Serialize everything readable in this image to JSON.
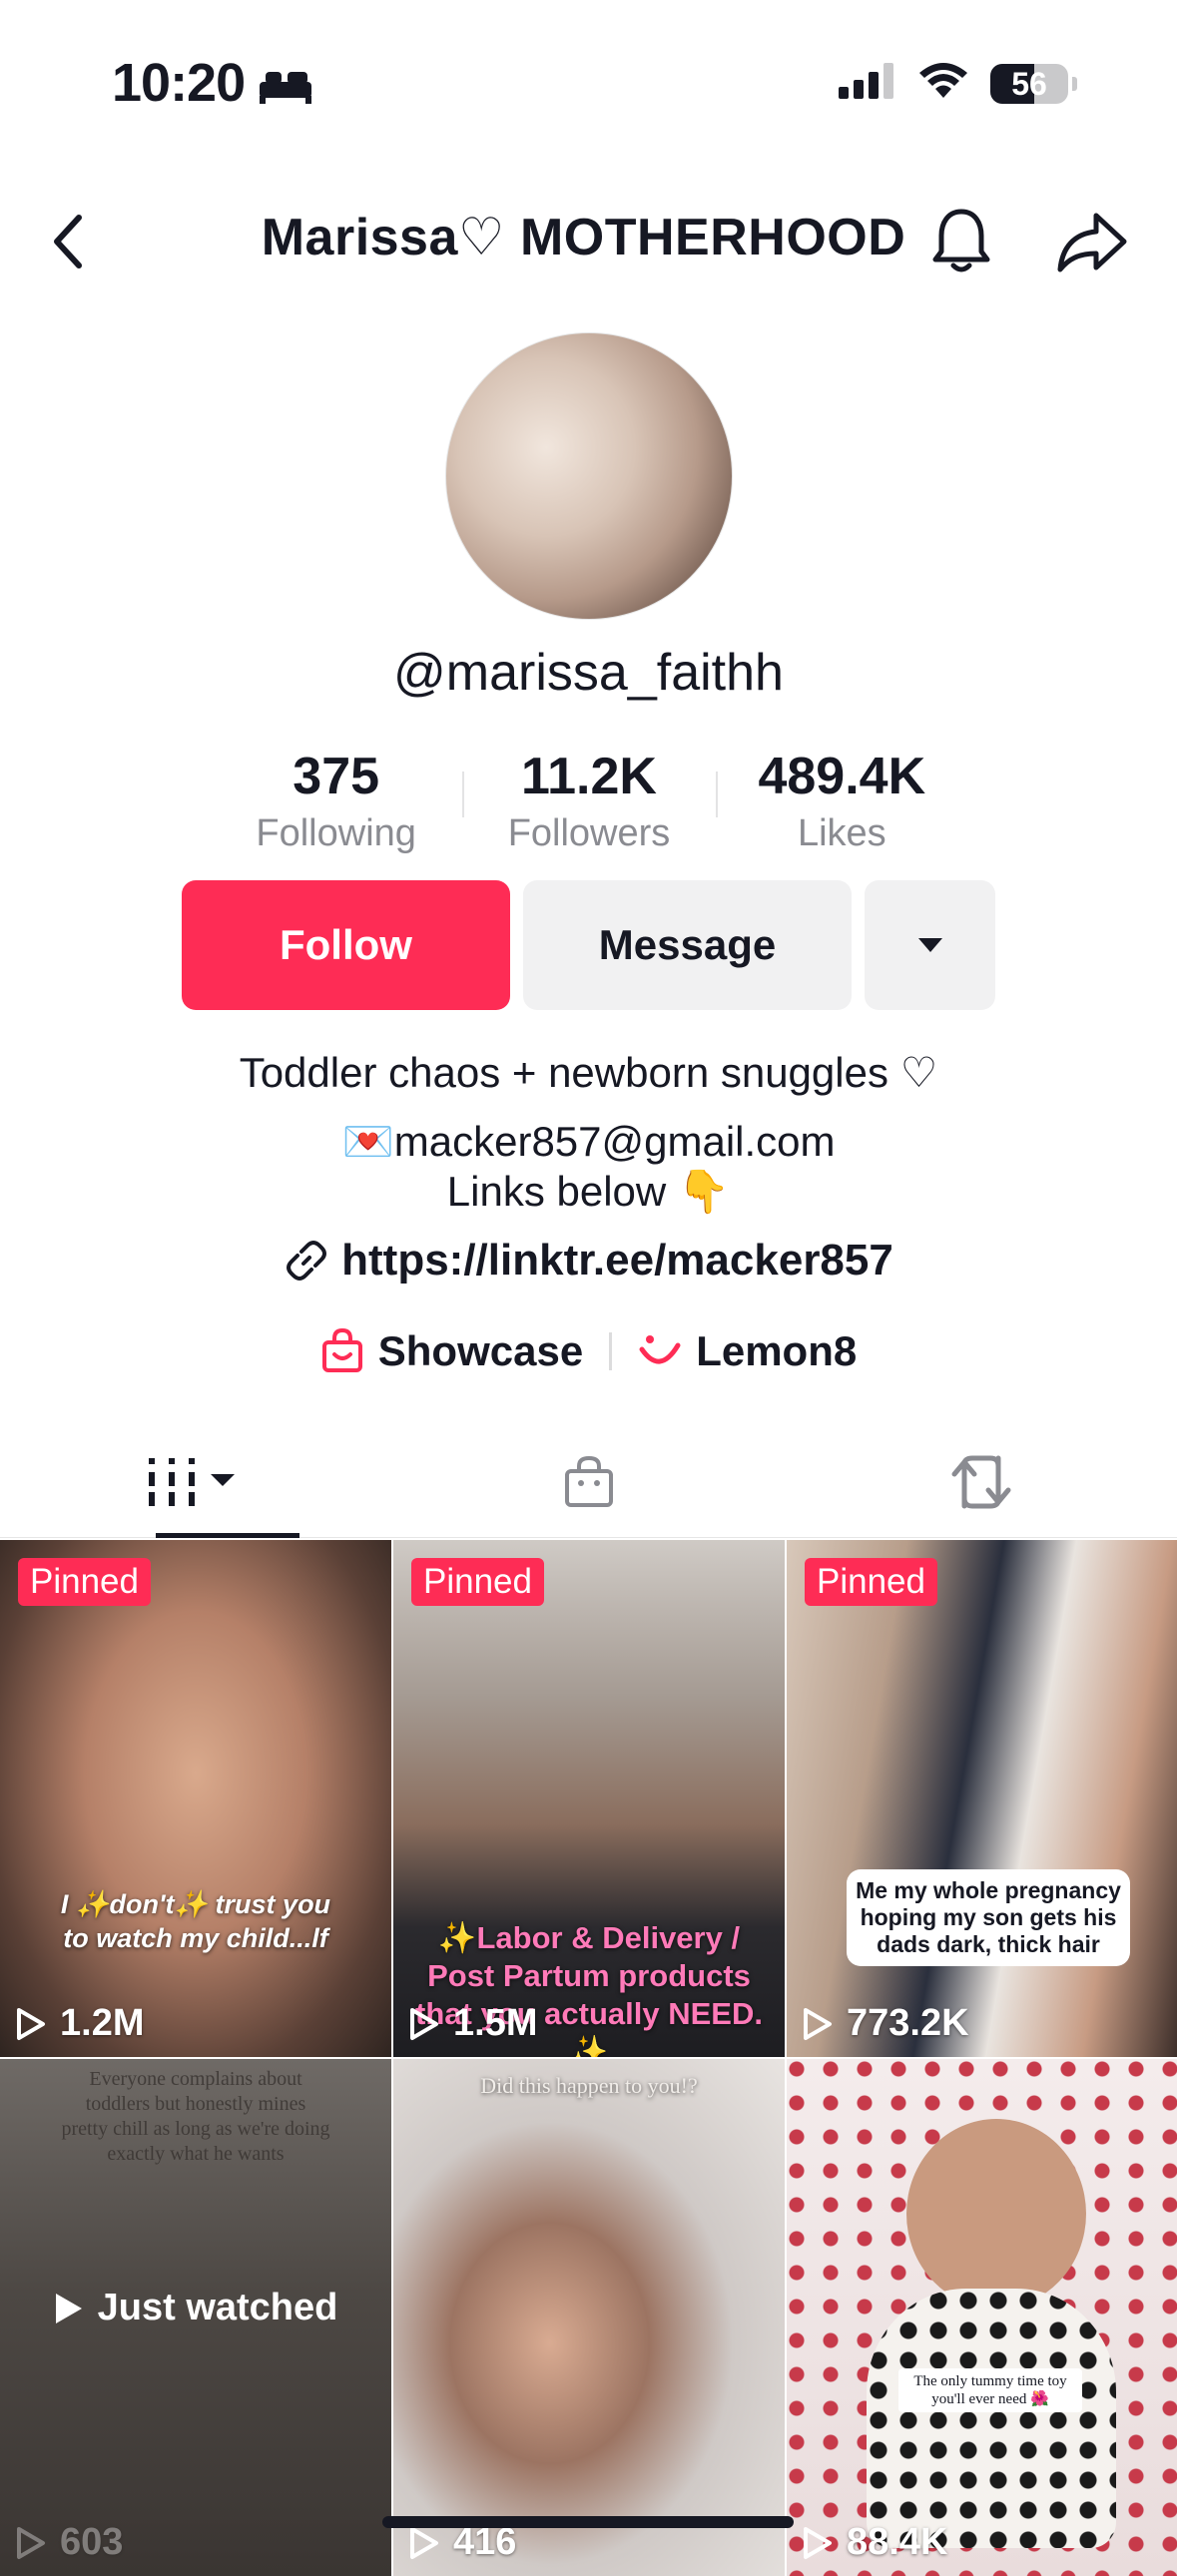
{
  "status_bar": {
    "time": "10:20",
    "battery": "56",
    "battery_level": 0.56
  },
  "header": {
    "title": "Marissa♡ MOTHERHOOD"
  },
  "profile": {
    "username": "@marissa_faithh",
    "stats": [
      {
        "value": "375",
        "label": "Following"
      },
      {
        "value": "11.2K",
        "label": "Followers"
      },
      {
        "value": "489.4K",
        "label": "Likes"
      }
    ],
    "follow_label": "Follow",
    "message_label": "Message",
    "bio_line1": "Toddler chaos + newborn snuggles ♡",
    "bio_line2": "💌macker857@gmail.com",
    "bio_line3": "Links below 👇",
    "link": "https://linktr.ee/macker857",
    "showcase_label": "Showcase",
    "lemon8_label": "Lemon8"
  },
  "colors": {
    "accent": "#fe2c55",
    "text": "#161823",
    "muted": "#8a8b91"
  },
  "videos": [
    {
      "pinned": "Pinned",
      "views": "1.2M",
      "caption": "I ✨don't✨ trust you to watch my child...lf"
    },
    {
      "pinned": "Pinned",
      "views": "1.5M",
      "caption": "✨Labor & Delivery / Post Partum products that you actually NEED. ✨"
    },
    {
      "pinned": "Pinned",
      "views": "773.2K",
      "caption": "Me my whole pregnancy hoping my son gets his dads dark, thick hair"
    },
    {
      "views": "603",
      "overlay": "Just watched",
      "caption": "Everyone complains about toddlers but honestly mines pretty chill as long as we're doing exactly what he wants"
    },
    {
      "views": "416",
      "caption": "Did this happen to you!?"
    },
    {
      "views": "88.4K",
      "caption": "The only tummy time toy you'll ever need 🌺"
    }
  ]
}
